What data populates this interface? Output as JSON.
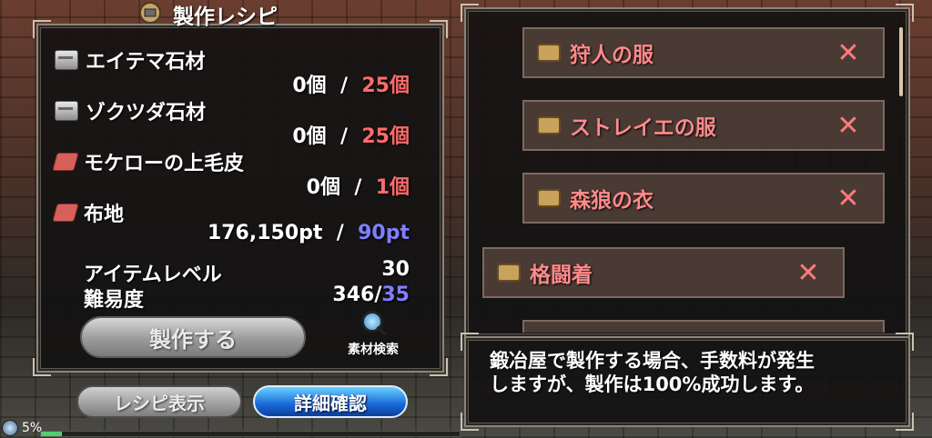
{
  "title": "製作レシピ",
  "materials": [
    {
      "name": "エイテマ石材",
      "icon": "stone-icon",
      "have": "0個",
      "need": "25個"
    },
    {
      "name": "ゾクツダ石材",
      "icon": "stone-icon",
      "have": "0個",
      "need": "25個"
    },
    {
      "name": "モケローの上毛皮",
      "icon": "hide-icon",
      "have": "0個",
      "need": "1個"
    },
    {
      "name": "布地",
      "icon": "hide-icon",
      "have": "176,150pt",
      "need": "90pt"
    }
  ],
  "separator": "/",
  "stats": {
    "item_level_label": "アイテムレベル",
    "item_level_value": "30",
    "difficulty_label": "難易度",
    "difficulty_have": "346/",
    "difficulty_need": "35"
  },
  "buttons": {
    "craft": "製作する",
    "search": "素材検索",
    "recipe_show": "レシピ表示",
    "detail": "詳細確認"
  },
  "recipe_list": [
    {
      "label": "狩人の服",
      "remove": "✕"
    },
    {
      "label": "ストレイエの服",
      "remove": "✕"
    },
    {
      "label": "森狼の衣",
      "remove": "✕"
    },
    {
      "label": "格闘着",
      "remove": "✕"
    }
  ],
  "message": {
    "line1": "鍛冶屋で製作する場合、手数料が発生",
    "line2": "しますが、製作は100%成功します。"
  },
  "status": {
    "percent": "5%",
    "progress": 0.05
  },
  "colors": {
    "need_red": "#ff6b6b",
    "need_blue": "#7f7fff",
    "detail_blue": "#1769d8",
    "recipe_text": "#ff8a8a"
  }
}
